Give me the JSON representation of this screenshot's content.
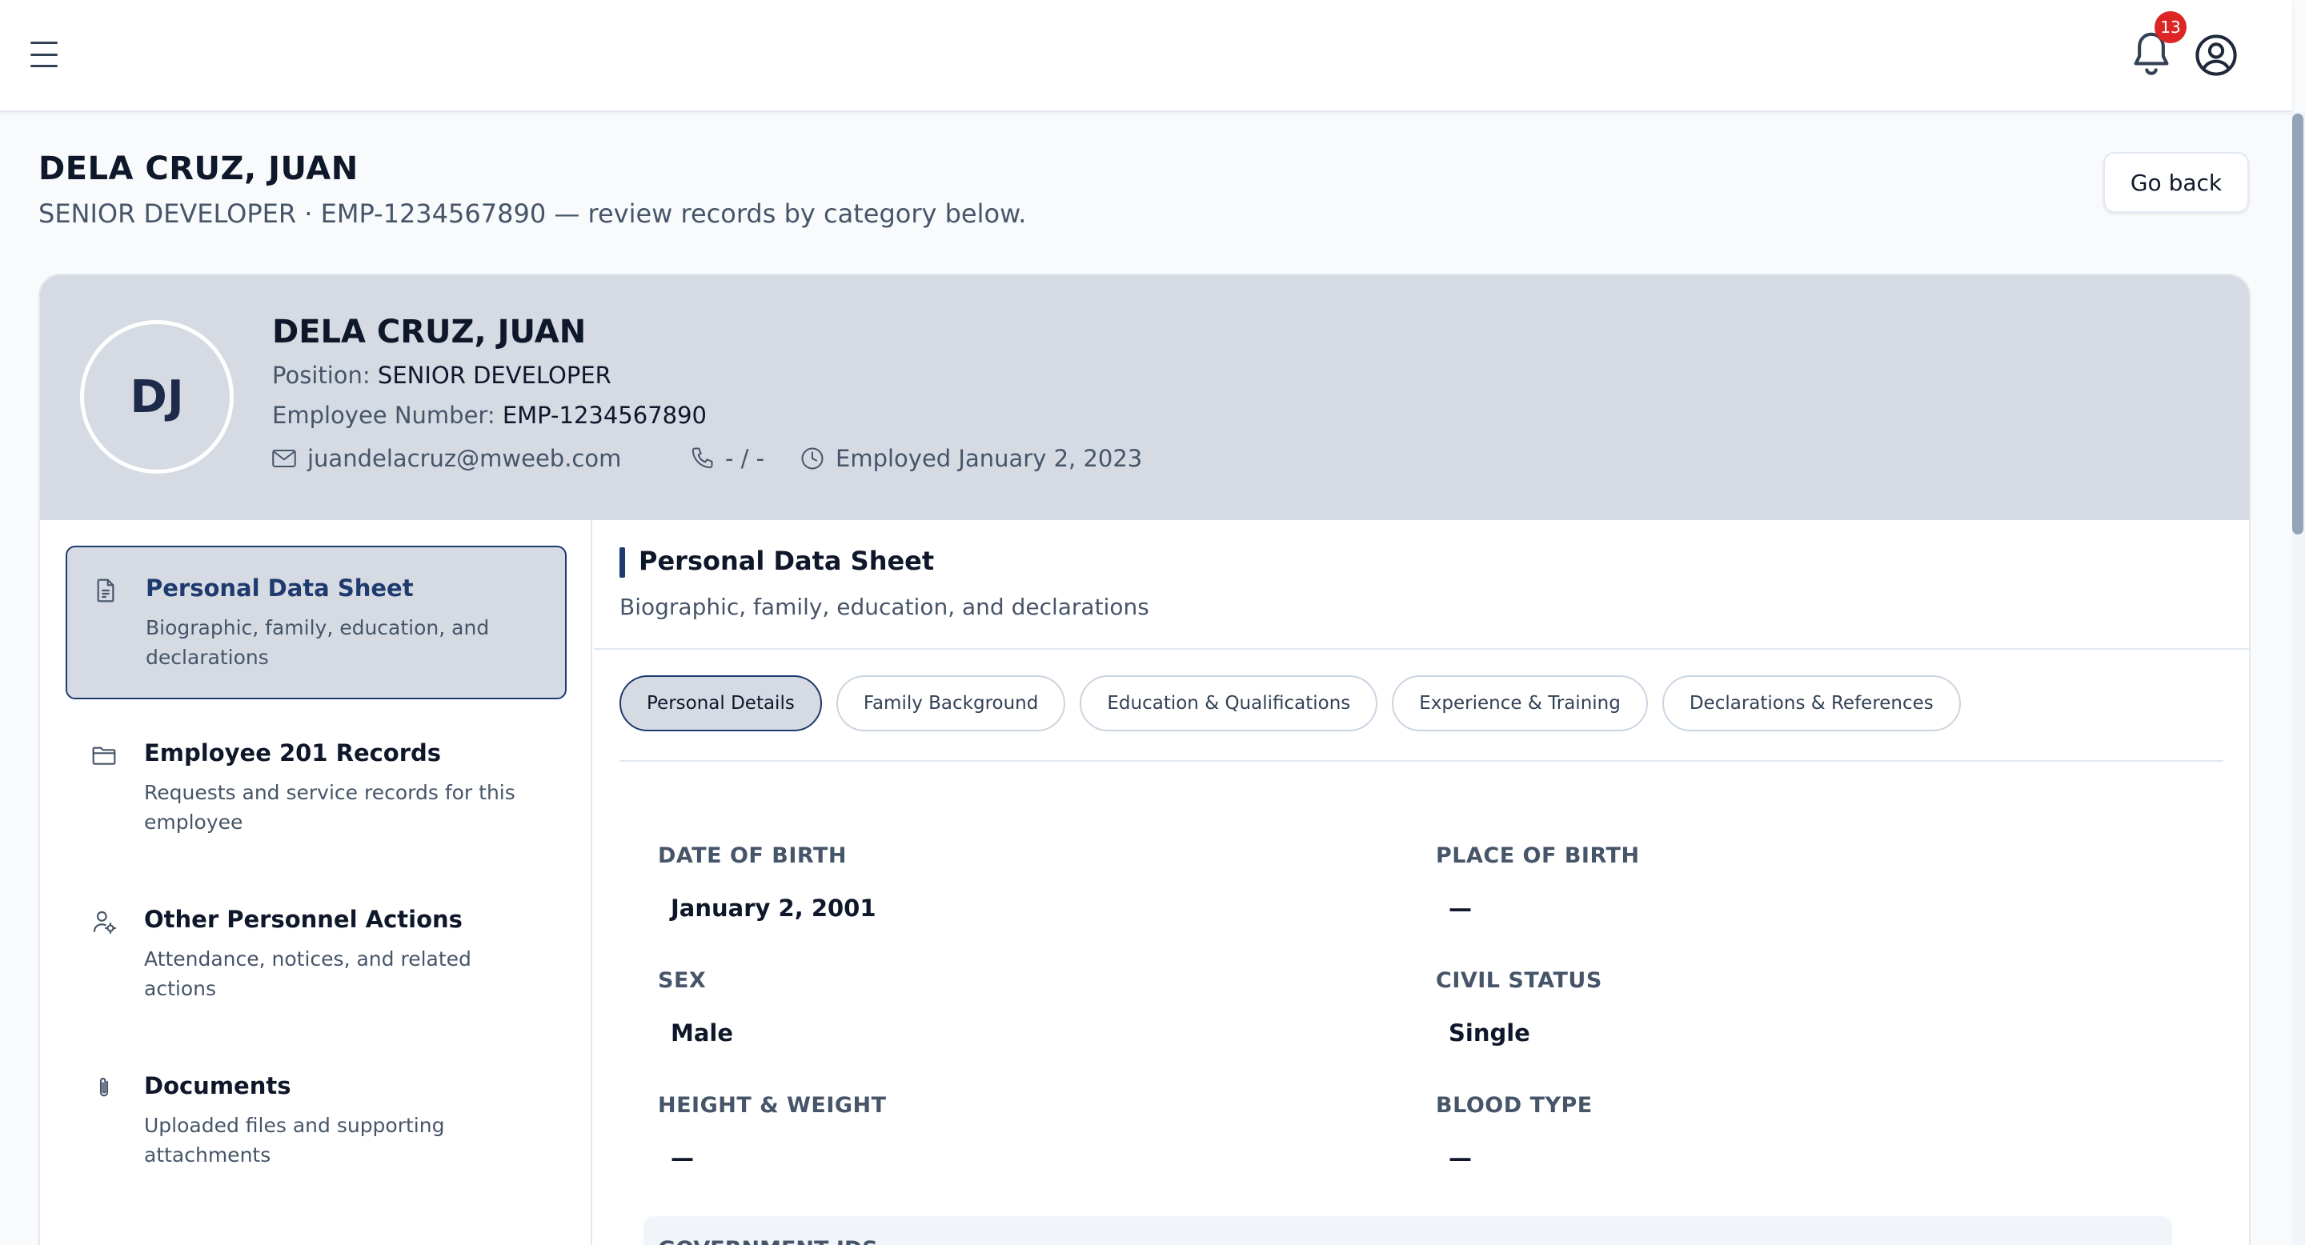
{
  "header": {
    "notification_count": "13"
  },
  "page": {
    "title": "DELA CRUZ, JUAN",
    "subtitle": "SENIOR DEVELOPER · EMP-1234567890 — review records by category below.",
    "go_back_label": "Go back"
  },
  "profile": {
    "initials": "DJ",
    "name": "DELA CRUZ, JUAN",
    "position_label": "Position:",
    "position_value": "SENIOR DEVELOPER",
    "employee_number_label": "Employee Number:",
    "employee_number_value": "EMP-1234567890",
    "email": "juandelacruz@mweeb.com",
    "phone": "- / -",
    "employed": "Employed January 2, 2023"
  },
  "nav": {
    "items": [
      {
        "title": "Personal Data Sheet",
        "desc": "Biographic, family, education, and declarations",
        "icon": "document-icon",
        "active": true
      },
      {
        "title": "Employee 201 Records",
        "desc": "Requests and service records for this employee",
        "icon": "folder-icon",
        "active": false
      },
      {
        "title": "Other Personnel Actions",
        "desc": "Attendance, notices, and related actions",
        "icon": "user-gear-icon",
        "active": false
      },
      {
        "title": "Documents",
        "desc": "Uploaded files and supporting attachments",
        "icon": "paperclip-icon",
        "active": false
      }
    ]
  },
  "section": {
    "title": "Personal Data Sheet",
    "description": "Biographic, family, education, and declarations"
  },
  "tabs": [
    {
      "label": "Personal Details",
      "active": true
    },
    {
      "label": "Family Background",
      "active": false
    },
    {
      "label": "Education & Qualifications",
      "active": false
    },
    {
      "label": "Experience & Training",
      "active": false
    },
    {
      "label": "Declarations & References",
      "active": false
    }
  ],
  "fields": {
    "date_of_birth": {
      "label": "DATE OF BIRTH",
      "value": "January 2, 2001"
    },
    "place_of_birth": {
      "label": "PLACE OF BIRTH",
      "value": "—"
    },
    "sex": {
      "label": "SEX",
      "value": "Male"
    },
    "civil_status": {
      "label": "CIVIL STATUS",
      "value": "Single"
    },
    "height_weight": {
      "label": "HEIGHT & WEIGHT",
      "value": "—"
    },
    "blood_type": {
      "label": "BLOOD TYPE",
      "value": "—"
    }
  },
  "government_ids": {
    "label": "GOVERNMENT IDS"
  },
  "colors": {
    "accent": "#1e3a6e",
    "band": "#d5dae3",
    "badge": "#dc2626"
  }
}
